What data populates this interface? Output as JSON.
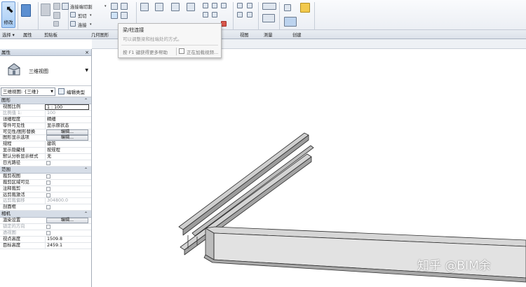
{
  "ribbon": {
    "modify_label": "修改",
    "groups": {
      "select": "选择 ▾",
      "properties": "属性",
      "clipboard": "剪贴板",
      "geometry": "几何图形",
      "view": "视图",
      "measure": "测量",
      "create": "创建"
    },
    "items": {
      "join_cut": "连接端切割",
      "cut": "剪切",
      "connect": "连接"
    }
  },
  "tooltip": {
    "title": "梁/柱连接",
    "description": "可以调整梁和柱端处的方式。",
    "help": "按 F1 键获得更多帮助",
    "loading": "正在加载视频..."
  },
  "properties": {
    "title": "属性",
    "close": "×",
    "type_name": "三维视图",
    "instance_filter": "三维视图: {三维}",
    "edit_type": "编辑类型",
    "groups": [
      {
        "name": "图形",
        "toggle": "⌃",
        "rows": [
          {
            "key": "视图比例",
            "value": "1 : 100",
            "kind": "boxed"
          },
          {
            "key": "比例值 1:",
            "value": "100",
            "kind": "dim"
          },
          {
            "key": "详细程度",
            "value": "精细",
            "kind": "text"
          },
          {
            "key": "零件可见性",
            "value": "显示原状态",
            "kind": "text"
          },
          {
            "key": "可见性/图形替换",
            "value": "编辑...",
            "kind": "button"
          },
          {
            "key": "图形显示选项",
            "value": "编辑...",
            "kind": "button"
          },
          {
            "key": "规程",
            "value": "建筑",
            "kind": "text"
          },
          {
            "key": "显示隐藏线",
            "value": "按规程",
            "kind": "text"
          },
          {
            "key": "默认分析显示样式",
            "value": "无",
            "kind": "text"
          },
          {
            "key": "日光路径",
            "value": "",
            "kind": "check"
          }
        ]
      },
      {
        "name": "范围",
        "toggle": "⌃",
        "rows": [
          {
            "key": "裁剪视图",
            "value": "",
            "kind": "check"
          },
          {
            "key": "裁剪区域可见",
            "value": "",
            "kind": "check"
          },
          {
            "key": "注释裁剪",
            "value": "",
            "kind": "check"
          },
          {
            "key": "远剪裁激活",
            "value": "",
            "kind": "check"
          },
          {
            "key": "远剪裁偏移",
            "value": "304800.0",
            "kind": "dim"
          },
          {
            "key": "剖面框",
            "value": "",
            "kind": "check"
          }
        ]
      },
      {
        "name": "相机",
        "toggle": "⌃",
        "rows": [
          {
            "key": "渲染设置",
            "value": "编辑...",
            "kind": "button"
          },
          {
            "key": "锁定的方向",
            "value": "",
            "kind": "checkdim"
          },
          {
            "key": "透视图",
            "value": "",
            "kind": "checkdim"
          },
          {
            "key": "视点高度",
            "value": "1509.8",
            "kind": "text"
          },
          {
            "key": "目标高度",
            "value": "2459.1",
            "kind": "text"
          }
        ]
      }
    ]
  },
  "watermark": "知乎 @BIM余"
}
